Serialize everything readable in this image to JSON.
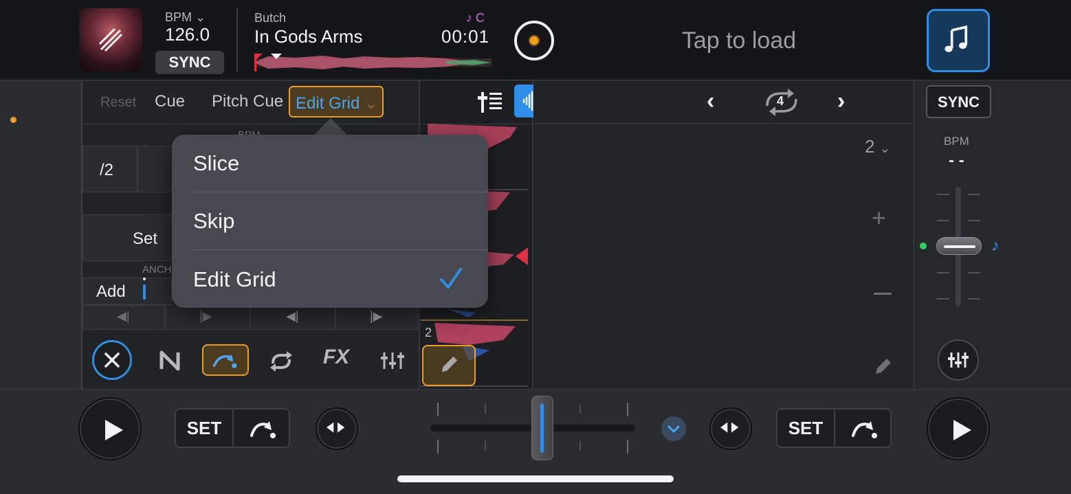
{
  "deck_left": {
    "bpm_label": "BPM",
    "bpm_value": "126.0",
    "sync_label": "SYNC",
    "artist": "Butch",
    "title": "In Gods Arms",
    "time": "00:01",
    "key": "♪ C"
  },
  "deck_right": {
    "tap_to_load": "Tap to load",
    "sync_label": "SYNC",
    "bpm_label": "BPM",
    "bpm_value": "- -",
    "zoom_value": "2"
  },
  "perf_tabs": {
    "reset": "Reset",
    "cue": "Cue",
    "pitch_cue": "Pitch Cue",
    "edit_grid": "Edit Grid"
  },
  "grid_editor": {
    "bpm_header": "BPM",
    "half": "/2",
    "set": "Set",
    "anchor": "ANCH",
    "add": "Add"
  },
  "dropdown": {
    "items": [
      "Slice",
      "Skip",
      "Edit Grid"
    ],
    "selected": "Edit Grid"
  },
  "waveform": {
    "beat_number": "2"
  },
  "loop": {
    "beats": "4"
  },
  "transport": {
    "set_label_left": "SET",
    "set_label_right": "SET"
  },
  "colors": {
    "accent_blue": "#2f8fe8",
    "highlight_orange": "#f09c2b",
    "key_magenta": "#d06bd8"
  }
}
